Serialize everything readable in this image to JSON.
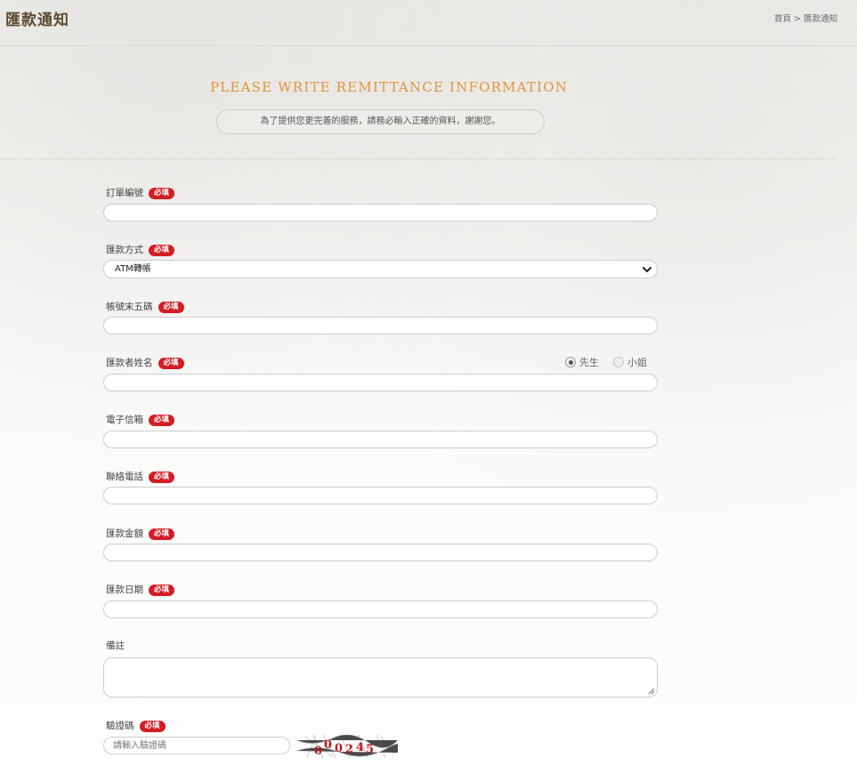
{
  "header": {
    "title": "匯款通知",
    "breadcrumb": {
      "home": "首頁",
      "separator": ">",
      "current": "匯款通知"
    }
  },
  "intro": {
    "heading": "PLEASE WRITE REMITTANCE INFORMATION",
    "notice": "為了提供您更完善的服務，請務必輸入正確的資料，謝謝您。"
  },
  "required_badge": "必填",
  "form": {
    "order_number": {
      "label": "訂單編號",
      "value": ""
    },
    "payment_method": {
      "label": "匯款方式",
      "selected": "ATM轉帳"
    },
    "account_last5": {
      "label": "帳號末五碼",
      "value": ""
    },
    "remitter_name": {
      "label": "匯款者姓名",
      "value": "",
      "salutation": {
        "options": [
          "先生",
          "小姐"
        ],
        "selected": "先生"
      }
    },
    "email": {
      "label": "電子信箱",
      "value": ""
    },
    "phone": {
      "label": "聯絡電話",
      "value": ""
    },
    "amount": {
      "label": "匯款金額",
      "value": ""
    },
    "date": {
      "label": "匯款日期",
      "value": ""
    },
    "note": {
      "label": "備註",
      "value": ""
    },
    "captcha": {
      "label": "驗證碼",
      "placeholder": "請輸入驗證碼",
      "image_text": "00245"
    }
  },
  "colors": {
    "heading": "#e0953a",
    "required_badge": "#d31d25",
    "title": "#5b4a33",
    "captcha_text": "#c0121a"
  }
}
